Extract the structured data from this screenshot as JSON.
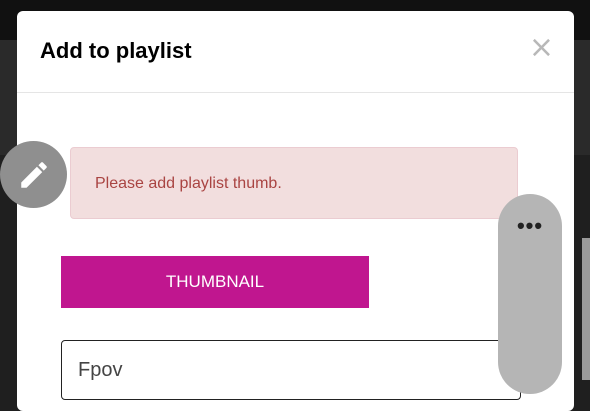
{
  "modal": {
    "title": "Add to playlist",
    "close_label": "×"
  },
  "alert": {
    "message": "Please add playlist thumb."
  },
  "thumbnail_button": {
    "label": "THUMBNAIL"
  },
  "playlist_name_input": {
    "value": "Fpov"
  },
  "floating_buttons": {
    "edit_icon": "pencil-icon",
    "more_label": "•••"
  },
  "colors": {
    "accent": "#c0168f",
    "alert_bg": "#f2dede",
    "alert_text": "#a94442"
  }
}
